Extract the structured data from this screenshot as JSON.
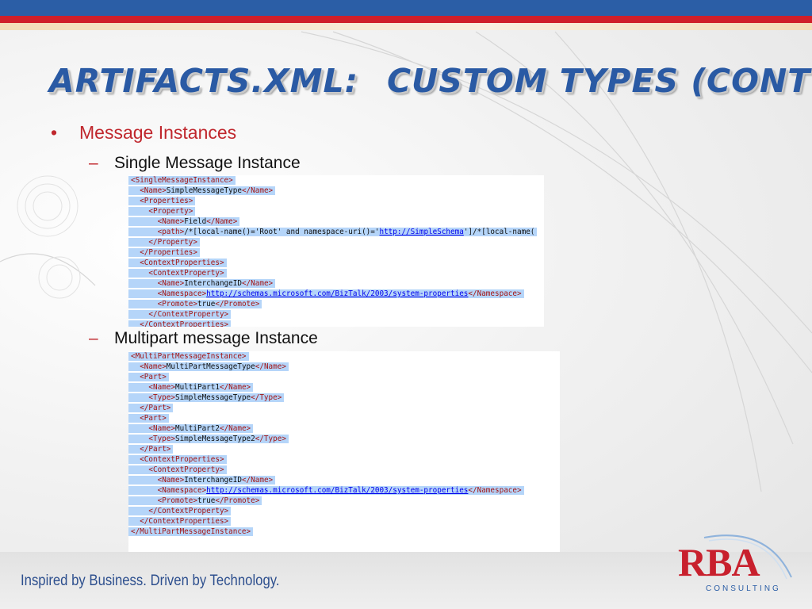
{
  "slide": {
    "title_part1": "ARTIFACTS.XML:",
    "title_part2": "CUSTOM TYPES (CONT'D)",
    "bullet": "Message Instances",
    "sub_bullets": [
      "Single Message Instance",
      "Multipart message Instance"
    ],
    "bullet_symbol": "•",
    "dash_symbol": "–"
  },
  "code_single": [
    [
      {
        "t": "tag",
        "v": "<SingleMessageInstance>"
      }
    ],
    [
      {
        "t": "txt",
        "v": "  "
      },
      {
        "t": "tag",
        "v": "<Name>"
      },
      {
        "t": "txt",
        "v": "SimpleMessageType"
      },
      {
        "t": "tag",
        "v": "</Name>"
      }
    ],
    [
      {
        "t": "txt",
        "v": "  "
      },
      {
        "t": "tag",
        "v": "<Properties>"
      }
    ],
    [
      {
        "t": "txt",
        "v": "    "
      },
      {
        "t": "tag",
        "v": "<Property>"
      }
    ],
    [
      {
        "t": "txt",
        "v": "      "
      },
      {
        "t": "tag",
        "v": "<Name>"
      },
      {
        "t": "txt",
        "v": "Field"
      },
      {
        "t": "tag",
        "v": "</Name>"
      }
    ],
    [
      {
        "t": "txt",
        "v": "      "
      },
      {
        "t": "tag",
        "v": "<path>"
      },
      {
        "t": "txt",
        "v": "/*[local-name()='Root' and namespace-uri()='"
      },
      {
        "t": "url",
        "v": "http://SimpleSchema"
      },
      {
        "t": "txt",
        "v": "']/*[local-name("
      }
    ],
    [
      {
        "t": "txt",
        "v": "    "
      },
      {
        "t": "tag",
        "v": "</Property>"
      }
    ],
    [
      {
        "t": "txt",
        "v": "  "
      },
      {
        "t": "tag",
        "v": "</Properties>"
      }
    ],
    [
      {
        "t": "txt",
        "v": "  "
      },
      {
        "t": "tag",
        "v": "<ContextProperties>"
      }
    ],
    [
      {
        "t": "txt",
        "v": "    "
      },
      {
        "t": "tag",
        "v": "<ContextProperty>"
      }
    ],
    [
      {
        "t": "txt",
        "v": "      "
      },
      {
        "t": "tag",
        "v": "<Name>"
      },
      {
        "t": "txt",
        "v": "InterchangeID"
      },
      {
        "t": "tag",
        "v": "</Name>"
      }
    ],
    [
      {
        "t": "txt",
        "v": "      "
      },
      {
        "t": "tag",
        "v": "<Namespace>"
      },
      {
        "t": "url",
        "v": "http://schemas.microsoft.com/BizTalk/2003/system-properties"
      },
      {
        "t": "tag",
        "v": "</Namespace>"
      }
    ],
    [
      {
        "t": "txt",
        "v": "      "
      },
      {
        "t": "tag",
        "v": "<Promote>"
      },
      {
        "t": "txt",
        "v": "true"
      },
      {
        "t": "tag",
        "v": "</Promote>"
      }
    ],
    [
      {
        "t": "txt",
        "v": "    "
      },
      {
        "t": "tag",
        "v": "</ContextProperty>"
      }
    ],
    [
      {
        "t": "txt",
        "v": "  "
      },
      {
        "t": "tag",
        "v": "</ContextProperties>"
      }
    ]
  ],
  "code_multi": [
    [
      {
        "t": "tag",
        "v": "<MultiPartMessageInstance>"
      }
    ],
    [
      {
        "t": "txt",
        "v": "  "
      },
      {
        "t": "tag",
        "v": "<Name>"
      },
      {
        "t": "txt",
        "v": "MultiPartMessageType"
      },
      {
        "t": "tag",
        "v": "</Name>"
      }
    ],
    [
      {
        "t": "txt",
        "v": "  "
      },
      {
        "t": "tag",
        "v": "<Part>"
      }
    ],
    [
      {
        "t": "txt",
        "v": "    "
      },
      {
        "t": "tag",
        "v": "<Name>"
      },
      {
        "t": "txt",
        "v": "MultiPart1"
      },
      {
        "t": "tag",
        "v": "</Name>"
      }
    ],
    [
      {
        "t": "txt",
        "v": "    "
      },
      {
        "t": "tag",
        "v": "<Type>"
      },
      {
        "t": "txt",
        "v": "SimpleMessageType"
      },
      {
        "t": "tag",
        "v": "</Type>"
      }
    ],
    [
      {
        "t": "txt",
        "v": "  "
      },
      {
        "t": "tag",
        "v": "</Part>"
      }
    ],
    [
      {
        "t": "txt",
        "v": "  "
      },
      {
        "t": "tag",
        "v": "<Part>"
      }
    ],
    [
      {
        "t": "txt",
        "v": "    "
      },
      {
        "t": "tag",
        "v": "<Name>"
      },
      {
        "t": "txt",
        "v": "MultiPart2"
      },
      {
        "t": "tag",
        "v": "</Name>"
      }
    ],
    [
      {
        "t": "txt",
        "v": "    "
      },
      {
        "t": "tag",
        "v": "<Type>"
      },
      {
        "t": "txt",
        "v": "SimpleMessageType2"
      },
      {
        "t": "tag",
        "v": "</Type>"
      }
    ],
    [
      {
        "t": "txt",
        "v": "  "
      },
      {
        "t": "tag",
        "v": "</Part>"
      }
    ],
    [
      {
        "t": "txt",
        "v": "  "
      },
      {
        "t": "tag",
        "v": "<ContextProperties>"
      }
    ],
    [
      {
        "t": "txt",
        "v": "    "
      },
      {
        "t": "tag",
        "v": "<ContextProperty>"
      }
    ],
    [
      {
        "t": "txt",
        "v": "      "
      },
      {
        "t": "tag",
        "v": "<Name>"
      },
      {
        "t": "txt",
        "v": "InterchangeID"
      },
      {
        "t": "tag",
        "v": "</Name>"
      }
    ],
    [
      {
        "t": "txt",
        "v": "      "
      },
      {
        "t": "tag",
        "v": "<Namespace>"
      },
      {
        "t": "url",
        "v": "http://schemas.microsoft.com/BizTalk/2003/system-properties"
      },
      {
        "t": "tag",
        "v": "</Namespace>"
      }
    ],
    [
      {
        "t": "txt",
        "v": "      "
      },
      {
        "t": "tag",
        "v": "<Promote>"
      },
      {
        "t": "txt",
        "v": "true"
      },
      {
        "t": "tag",
        "v": "</Promote>"
      }
    ],
    [
      {
        "t": "txt",
        "v": "    "
      },
      {
        "t": "tag",
        "v": "</ContextProperty>"
      }
    ],
    [
      {
        "t": "txt",
        "v": "  "
      },
      {
        "t": "tag",
        "v": "</ContextProperties>"
      }
    ],
    [
      {
        "t": "tag",
        "v": "</MultiPartMessageInstance>"
      }
    ]
  ],
  "footer": {
    "tagline": "Inspired by Business. Driven by Technology.",
    "logo_text": "RBA",
    "logo_sub": "CONSULTING"
  },
  "colors": {
    "title_blue": "#2a5aa4",
    "bullet_red": "#c0272d",
    "band_blue": "#2b5ea6",
    "band_red": "#cf1f2a",
    "selection_blue": "#b5d5f9"
  }
}
